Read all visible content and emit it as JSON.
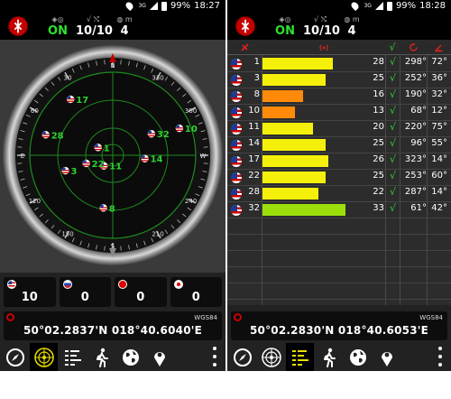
{
  "left": {
    "status": {
      "battery": "99%",
      "time": "18:27",
      "net": "3G"
    },
    "header": {
      "fix_icon": "gps-fix-icon",
      "fix_value": "ON",
      "used_icon": "check-satellite-icon",
      "used_value": "10/10",
      "sats_icon": "satellite-count-icon",
      "sats_value": "4"
    },
    "radar": {
      "ring_labels": [
        "N",
        "330",
        "300",
        "W",
        "240",
        "210",
        "S",
        "150",
        "120",
        "E",
        "60",
        "30"
      ],
      "satellites": [
        {
          "prn": "1",
          "azimuth": 298,
          "elevation": 72,
          "color": "#2fd12f"
        },
        {
          "prn": "3",
          "azimuth": 252,
          "elevation": 36,
          "color": "#2fd12f"
        },
        {
          "prn": "8",
          "azimuth": 190,
          "elevation": 32,
          "color": "#2fd12f"
        },
        {
          "prn": "10",
          "azimuth": 68,
          "elevation": 12,
          "color": "#2fd12f"
        },
        {
          "prn": "11",
          "azimuth": 220,
          "elevation": 75,
          "color": "#2fd12f"
        },
        {
          "prn": "14",
          "azimuth": 96,
          "elevation": 55,
          "color": "#2fd12f"
        },
        {
          "prn": "17",
          "azimuth": 323,
          "elevation": 14,
          "color": "#2fd12f"
        },
        {
          "prn": "22",
          "azimuth": 253,
          "elevation": 60,
          "color": "#2fd12f"
        },
        {
          "prn": "28",
          "azimuth": 287,
          "elevation": 14,
          "color": "#2fd12f"
        },
        {
          "prn": "32",
          "azimuth": 61,
          "elevation": 42,
          "color": "#2fd12f"
        }
      ]
    },
    "constellations": [
      {
        "name": "GPS",
        "flag": "us",
        "count": "10"
      },
      {
        "name": "GLONASS",
        "flag": "ru",
        "count": "0"
      },
      {
        "name": "BeiDou",
        "flag": "cn",
        "count": "0"
      },
      {
        "name": "QZSS",
        "flag": "jp",
        "count": "0"
      }
    ],
    "location": {
      "datum": "WGS84",
      "coords": "50°02.2837'N  018°40.6040'E"
    },
    "nav": [
      "compass-icon",
      "radar-icon",
      "bars-icon",
      "walk-icon",
      "globe-icon",
      "pin-icon"
    ]
  },
  "right": {
    "status": {
      "battery": "99%",
      "time": "18:28",
      "net": "3G"
    },
    "header": {
      "fix_icon": "gps-fix-icon",
      "fix_value": "ON",
      "used_icon": "check-satellite-icon",
      "used_value": "10/10",
      "sats_icon": "satellite-count-icon",
      "sats_value": "4"
    },
    "table": {
      "columns": [
        "satellite-icon",
        "signal-icon",
        "check-icon",
        "azimuth-icon",
        "elevation-icon"
      ],
      "rows": [
        {
          "prn": "1",
          "snr": "28",
          "used": "√",
          "azimuth": "298°",
          "elevation": "72°",
          "color": "#f5f00a"
        },
        {
          "prn": "3",
          "snr": "25",
          "used": "√",
          "azimuth": "252°",
          "elevation": "36°",
          "color": "#f5f00a"
        },
        {
          "prn": "8",
          "snr": "16",
          "used": "√",
          "azimuth": "190°",
          "elevation": "32°",
          "color": "#ff8a0a"
        },
        {
          "prn": "10",
          "snr": "13",
          "used": "√",
          "azimuth": "68°",
          "elevation": "12°",
          "color": "#ff8a0a"
        },
        {
          "prn": "11",
          "snr": "20",
          "used": "√",
          "azimuth": "220°",
          "elevation": "75°",
          "color": "#f5f00a"
        },
        {
          "prn": "14",
          "snr": "25",
          "used": "√",
          "azimuth": "96°",
          "elevation": "55°",
          "color": "#f5f00a"
        },
        {
          "prn": "17",
          "snr": "26",
          "used": "√",
          "azimuth": "323°",
          "elevation": "14°",
          "color": "#f5f00a"
        },
        {
          "prn": "22",
          "snr": "25",
          "used": "√",
          "azimuth": "253°",
          "elevation": "60°",
          "color": "#f5f00a"
        },
        {
          "prn": "28",
          "snr": "22",
          "used": "√",
          "azimuth": "287°",
          "elevation": "14°",
          "color": "#f5f00a"
        },
        {
          "prn": "32",
          "snr": "33",
          "used": "√",
          "azimuth": "61°",
          "elevation": "42°",
          "color": "#9be00a"
        }
      ]
    },
    "location": {
      "datum": "WGS84",
      "coords": "50°02.2830'N  018°40.6053'E"
    },
    "nav": [
      "compass-icon",
      "radar-icon",
      "bars-icon",
      "walk-icon",
      "globe-icon",
      "pin-icon"
    ]
  }
}
